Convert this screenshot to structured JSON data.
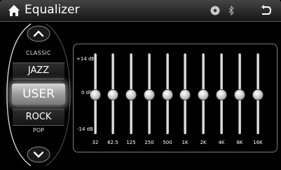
{
  "header": {
    "title": "Equalizer",
    "icons": {
      "home": "home-icon",
      "disc": "disc-icon",
      "bluetooth": "bluetooth-icon",
      "back": "back-icon"
    }
  },
  "presets": {
    "items": [
      {
        "key": "classic",
        "label": "CLASSIC"
      },
      {
        "key": "jazz",
        "label": "JAZZ"
      },
      {
        "key": "user",
        "label": "USER",
        "selected": true
      },
      {
        "key": "rock",
        "label": "ROCK"
      },
      {
        "key": "pop",
        "label": "POP"
      }
    ],
    "up_icon": "chevron-up-icon",
    "down_icon": "chevron-down-icon"
  },
  "eq": {
    "db_labels": {
      "top": "+14 dB",
      "mid": "0 dB",
      "bottom": "-14 dB"
    },
    "db_range": [
      -14,
      14
    ],
    "bands": [
      {
        "freq": "32",
        "gain_db": 0
      },
      {
        "freq": "62.5",
        "gain_db": 0
      },
      {
        "freq": "125",
        "gain_db": 0
      },
      {
        "freq": "250",
        "gain_db": 0
      },
      {
        "freq": "500",
        "gain_db": 0
      },
      {
        "freq": "1K",
        "gain_db": 0
      },
      {
        "freq": "2K",
        "gain_db": 0
      },
      {
        "freq": "4K",
        "gain_db": 0
      },
      {
        "freq": "8K",
        "gain_db": 0
      },
      {
        "freq": "16K",
        "gain_db": 0
      }
    ]
  },
  "colors": {
    "background": "#000000",
    "selected_preset": "#b0b0b0",
    "text": "#ffffff"
  }
}
